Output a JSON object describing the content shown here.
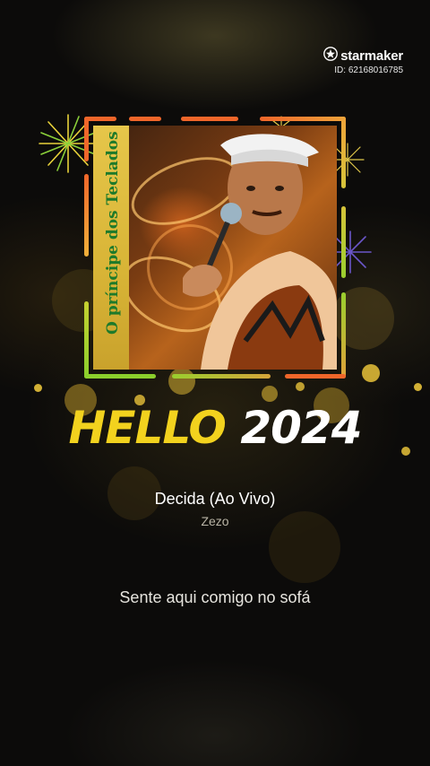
{
  "brand": {
    "name": "starmaker",
    "id_text": "ID: 62168016785",
    "icon": "star-logo-icon"
  },
  "cover": {
    "spine_text": "O príncipe dos Teclados"
  },
  "headline": {
    "hello": "HELLO",
    "year": "2024"
  },
  "song": {
    "title": "Decida (Ao Vivo)",
    "artist": "Zezo"
  },
  "lyric": {
    "current_line": "Sente aqui comigo no sofá"
  },
  "colors": {
    "headline_yellow": "#f2d21e",
    "frame_orange": "#f0662a",
    "frame_green": "#8bcf2c",
    "background": "#0c0b0a"
  }
}
